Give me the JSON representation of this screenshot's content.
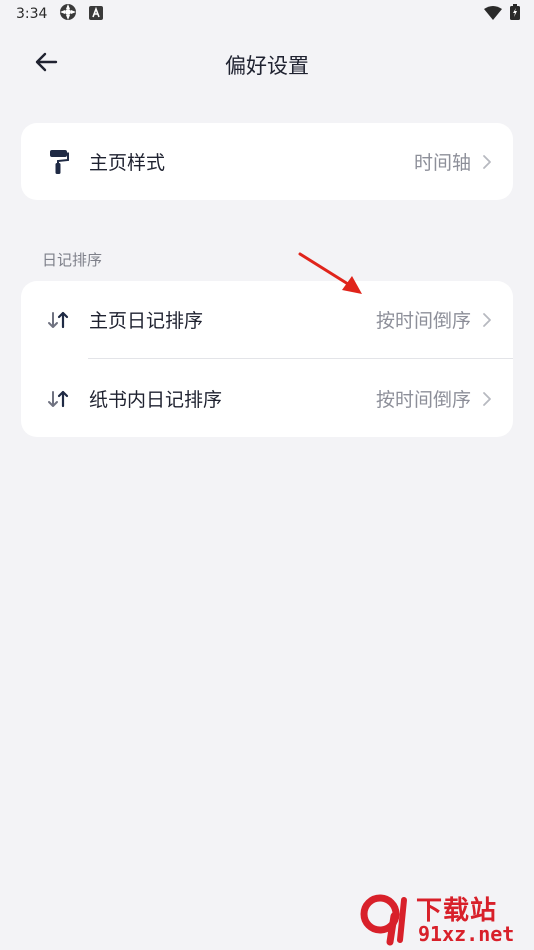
{
  "status_bar": {
    "time": "3:34"
  },
  "header": {
    "title": "偏好设置",
    "back_icon": "arrow-left-icon"
  },
  "home_style": {
    "label": "主页样式",
    "value": "时间轴",
    "icon": "paint-roller-icon"
  },
  "diary_sort": {
    "section_title": "日记排序",
    "items": [
      {
        "label": "主页日记排序",
        "value": "按时间倒序",
        "icon": "sort-arrows-icon"
      },
      {
        "label": "纸书内日记排序",
        "value": "按时间倒序",
        "icon": "sort-arrows-icon"
      }
    ]
  },
  "watermark": {
    "title": "下载站",
    "url": "91xz.net"
  },
  "colors": {
    "background": "#f3f3f6",
    "card": "#ffffff",
    "text_primary": "#1f2230",
    "text_secondary": "#8d8f99",
    "annotation": "#e0241b",
    "watermark": "#d8202a"
  }
}
